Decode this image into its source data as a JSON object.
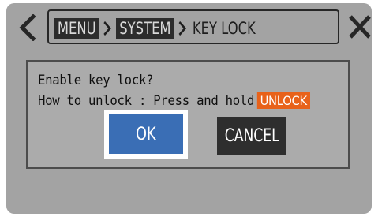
{
  "header": {
    "breadcrumb": [
      "MENU",
      "SYSTEM",
      "KEY LOCK"
    ],
    "back_icon": "chevron-left-icon",
    "close_icon": "close-icon",
    "separator_icon": "chevron-right-icon"
  },
  "dialog": {
    "line1": "Enable key lock?",
    "line2_prefix": "How to unlock : Press and hold",
    "unlock_key": "UNLOCK",
    "ok_label": "OK",
    "cancel_label": "CANCEL"
  },
  "colors": {
    "screen_bg": "#a3a3a3",
    "ok_blue": "#3a6eb5",
    "unlock_orange": "#e8621a",
    "cancel_dark": "#2e2e2e"
  }
}
